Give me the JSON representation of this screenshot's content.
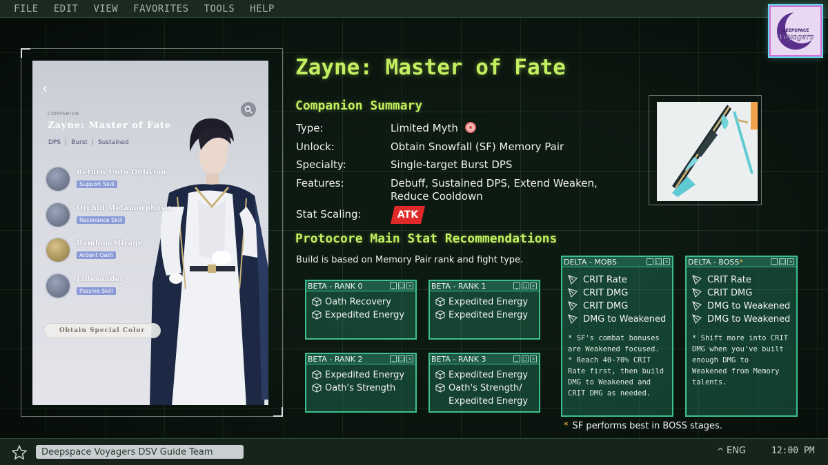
{
  "menubar": {
    "items": [
      "FILE",
      "EDIT",
      "VIEW",
      "FAVORITES",
      "TOOLS",
      "HELP"
    ]
  },
  "logo": {
    "text": "DEEPSPACE Voyagers",
    "icon": "crescent-moon-logo"
  },
  "card": {
    "back_icon": "‹",
    "companion_label": "COMPANION",
    "name": "Zayne: Master of Fate",
    "roles": [
      "DPS",
      "Burst",
      "Sustained"
    ],
    "skills": [
      {
        "name": "Return Unto Oblivion",
        "tag": "Support Skill"
      },
      {
        "name": "Orchid Metamorphosis",
        "tag": "Resonance Skill"
      },
      {
        "name": "Bamboo Mirage",
        "tag": "Ardent Oath"
      },
      {
        "name": "Jadesunder",
        "tag": "Passive Skill"
      }
    ],
    "obtain_label": "Obtain Special Color"
  },
  "title": "Zayne: Master of Fate",
  "summary": {
    "heading": "Companion Summary",
    "type_label": "Type:",
    "type_value": "Limited Myth",
    "unlock_label": "Unlock:",
    "unlock_value": "Obtain Snowfall (SF) Memory Pair",
    "specialty_label": "Specialty:",
    "specialty_value": "Single-target Burst DPS",
    "features_label": "Features:",
    "features_value_1": "Debuff, Sustained DPS, Extend Weaken,",
    "features_value_2": "Reduce Cooldown",
    "stat_label": "Stat Scaling:",
    "stat_value": "ATK"
  },
  "protocore": {
    "heading": "Protocore Main Stat Recommendations",
    "note": "Build is based on Memory Pair rank and fight type."
  },
  "windows": {
    "beta0": {
      "title": "BETA - RANK 0",
      "lines": [
        "Oath Recovery",
        "Expedited Energy"
      ]
    },
    "beta1": {
      "title": "BETA - RANK 1",
      "lines": [
        "Expedited Energy",
        "Expedited Energy"
      ]
    },
    "beta2": {
      "title": "BETA - RANK 2",
      "lines": [
        "Expedited Energy",
        "Oath's Strength"
      ]
    },
    "beta3": {
      "title": "BETA - RANK 3",
      "lines": [
        "Expedited Energy",
        "Oath's Strength/",
        "Expedited Energy"
      ]
    },
    "mobs": {
      "title": "DELTA - MOBS",
      "lines": [
        "CRIT Rate",
        "CRIT DMG",
        "CRIT DMG",
        "DMG to Weakened"
      ],
      "note_1": "* SF's combat bonuses",
      "note_2": "are Weakened focused.",
      "note_3": "* Reach 40-70% CRIT",
      "note_4": "Rate first, then build",
      "note_5": "DMG to Weakened and",
      "note_6": "CRIT DMG as needed."
    },
    "boss": {
      "title": "DELTA - BOSS",
      "title_mark": "*",
      "lines": [
        "CRIT Rate",
        "CRIT DMG",
        "DMG to Weakened",
        "DMG to Weakened"
      ],
      "note_1": "* Shift more into CRIT",
      "note_2": "DMG when you've built",
      "note_3": "enough DMG to",
      "note_4": "Weakened from Memory",
      "note_5": "talents."
    }
  },
  "footnote": {
    "mark": "*",
    "text": "SF performs best in BOSS stages."
  },
  "taskbar": {
    "app": "Deepspace Voyagers DSV Guide Team",
    "tray_arrow": "^",
    "lang": "ENG",
    "time": "12:00 PM"
  },
  "colors": {
    "accent": "#c3f060",
    "window": "#3fbf8f",
    "atk": "#e02a2a"
  }
}
